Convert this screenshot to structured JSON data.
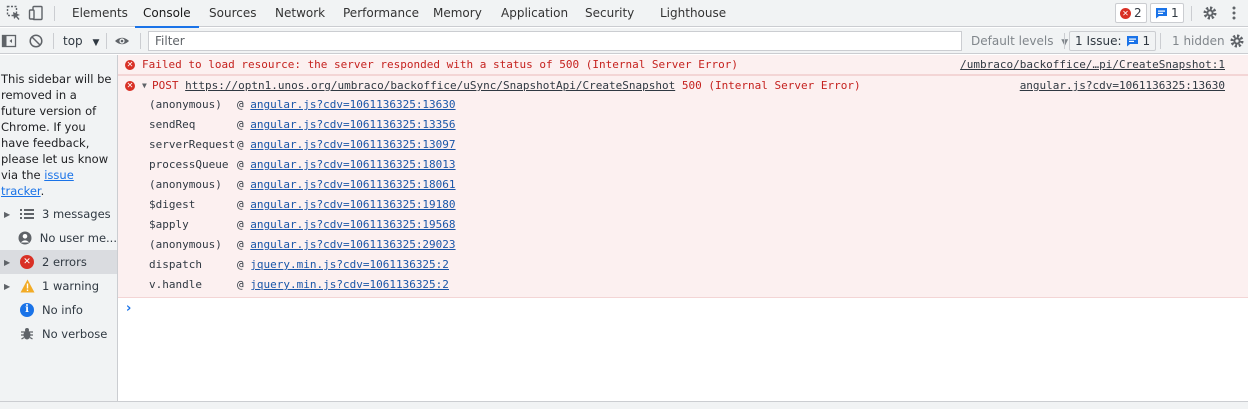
{
  "tabs": [
    "Elements",
    "Console",
    "Sources",
    "Network",
    "Performance",
    "Memory",
    "Application",
    "Security",
    "Lighthouse"
  ],
  "active_tab": "Console",
  "badges": {
    "errors": "2",
    "messages": "1"
  },
  "toolbar": {
    "context": "top",
    "filter_placeholder": "Filter",
    "levels": "Default levels",
    "issues_label": "1 Issue:",
    "issues_count": "1",
    "hidden": "1 hidden"
  },
  "sidebar": {
    "note": "This sidebar will be removed in a future version of Chrome. If you have feedback, please let us know via the",
    "note_link": "issue tracker",
    "note_end": ".",
    "items": [
      {
        "label": "3 messages",
        "icon": "list-icon"
      },
      {
        "label": "No user me...",
        "icon": "user-icon"
      },
      {
        "label": "2 errors",
        "icon": "error-icon"
      },
      {
        "label": "1 warning",
        "icon": "warning-icon"
      },
      {
        "label": "No info",
        "icon": "info-icon"
      },
      {
        "label": "No verbose",
        "icon": "bug-icon"
      }
    ]
  },
  "console": {
    "error1": {
      "text": "Failed to load resource: the server responded with a status of 500 (Internal Server Error)",
      "source": "/umbraco/backoffice/…pi/CreateSnapshot:1"
    },
    "error2": {
      "method": "POST",
      "url": "https://optn1.unos.org/umbraco/backoffice/uSync/SnapshotApi/CreateSnapshot",
      "status": "500 (Internal Server Error)",
      "source": "angular.js?cdv=1061136325:13630"
    },
    "stack": [
      {
        "fn": "(anonymous)",
        "link": "angular.js?cdv=1061136325:13630"
      },
      {
        "fn": "sendReq",
        "link": "angular.js?cdv=1061136325:13356"
      },
      {
        "fn": "serverRequest",
        "link": "angular.js?cdv=1061136325:13097"
      },
      {
        "fn": "processQueue",
        "link": "angular.js?cdv=1061136325:18013"
      },
      {
        "fn": "(anonymous)",
        "link": "angular.js?cdv=1061136325:18061"
      },
      {
        "fn": "$digest",
        "link": "angular.js?cdv=1061136325:19180"
      },
      {
        "fn": "$apply",
        "link": "angular.js?cdv=1061136325:19568"
      },
      {
        "fn": "(anonymous)",
        "link": "angular.js?cdv=1061136325:29023"
      },
      {
        "fn": "dispatch",
        "link": "jquery.min.js?cdv=1061136325:2"
      },
      {
        "fn": "v.handle",
        "link": "jquery.min.js?cdv=1061136325:2"
      }
    ],
    "at": "@",
    "prompt": "›"
  },
  "colors": {
    "accent": "#1a73e8",
    "error": "#d93025",
    "error_bg": "#fcf0f0"
  }
}
